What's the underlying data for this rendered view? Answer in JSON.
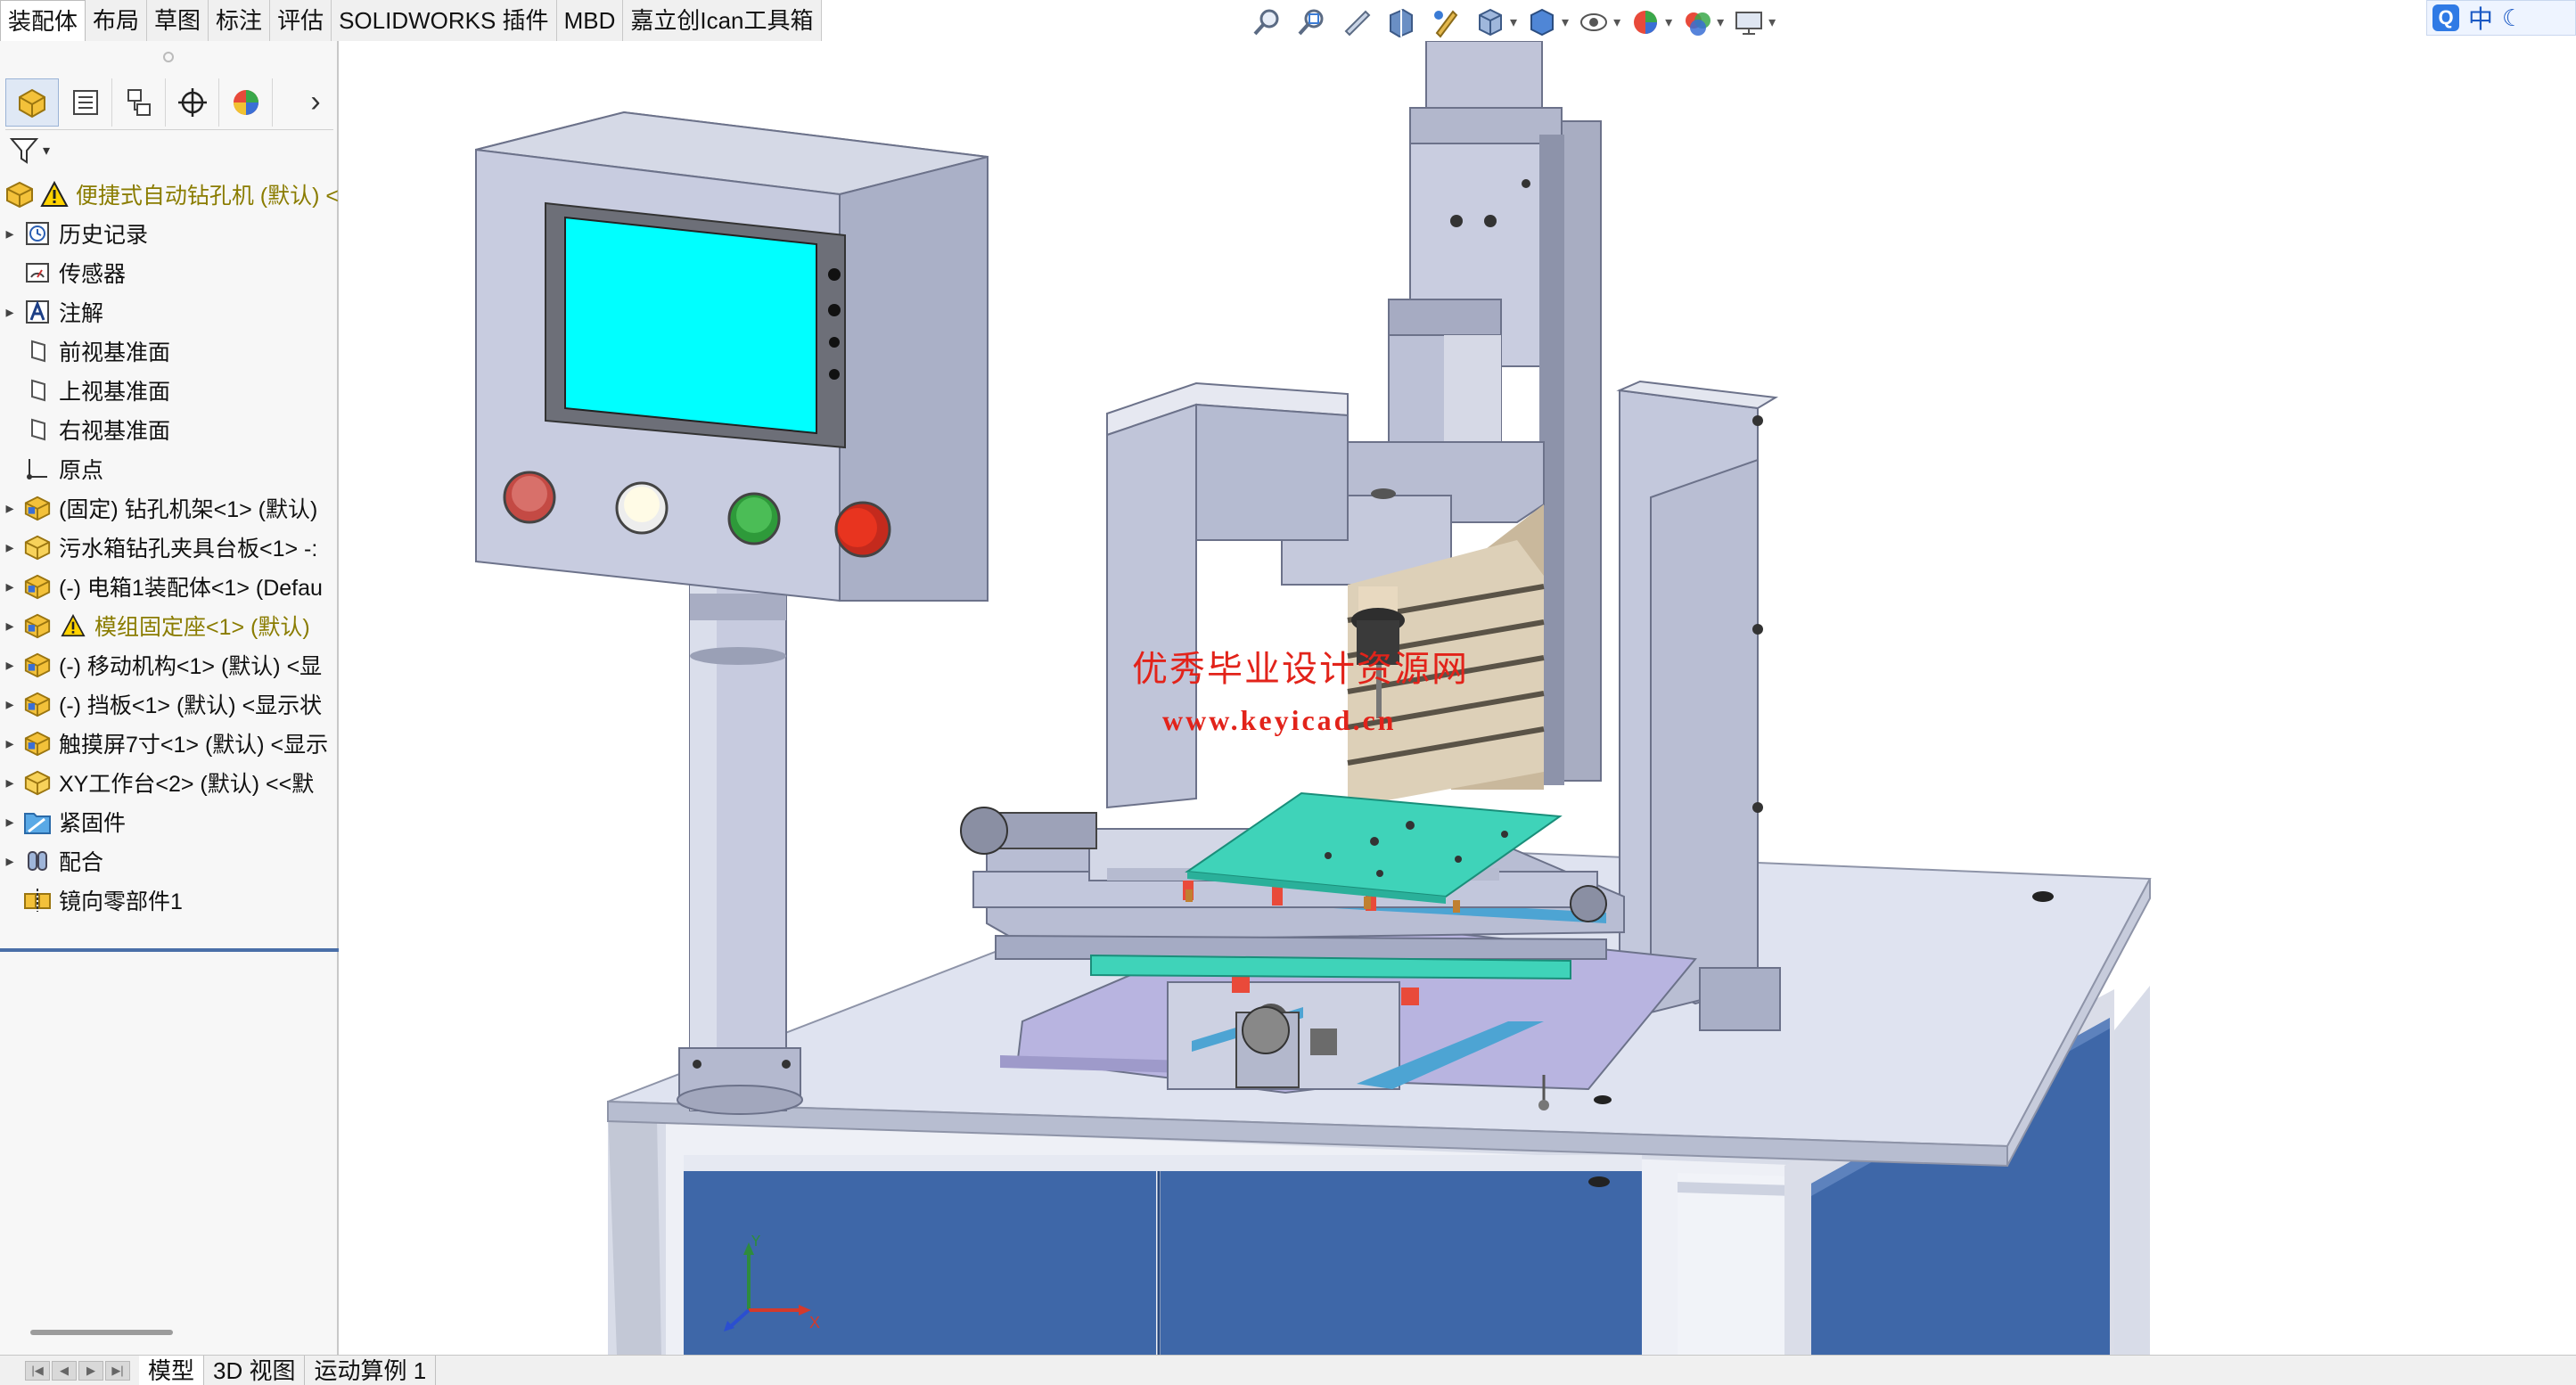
{
  "tabs": [
    {
      "label": "装配体"
    },
    {
      "label": "布局"
    },
    {
      "label": "草图"
    },
    {
      "label": "标注"
    },
    {
      "label": "评估"
    },
    {
      "label": "SOLIDWORKS 插件"
    },
    {
      "label": "MBD"
    },
    {
      "label": "嘉立创Ican工具箱"
    }
  ],
  "hud_icons": [
    "zoom-to-fit-icon",
    "zoom-area-icon",
    "previous-view-icon",
    "section-view-icon",
    "dynamic-annotation-icon",
    "view-orientation-icon",
    "display-style-icon",
    "hide-show-icon",
    "edit-appearance-icon",
    "apply-scene-icon",
    "view-settings-icon"
  ],
  "ime": {
    "lang": "中",
    "mode": "☾"
  },
  "feature_tree": {
    "root": {
      "label": "便捷式自动钻孔机 (默认) <"
    },
    "items": [
      {
        "label": "历史记录",
        "icon": "history-icon",
        "expandable": true
      },
      {
        "label": "传感器",
        "icon": "sensor-icon",
        "expandable": false
      },
      {
        "label": "注解",
        "icon": "annotation-icon",
        "expandable": true
      },
      {
        "label": "前视基准面",
        "icon": "plane-icon",
        "expandable": false
      },
      {
        "label": "上视基准面",
        "icon": "plane-icon",
        "expandable": false
      },
      {
        "label": "右视基准面",
        "icon": "plane-icon",
        "expandable": false
      },
      {
        "label": "原点",
        "icon": "origin-icon",
        "expandable": false
      },
      {
        "label": "(固定) 钻孔机架<1> (默认)",
        "icon": "subassembly-icon",
        "expandable": true
      },
      {
        "label": "污水箱钻孔夹具台板<1> -:",
        "icon": "part-icon",
        "expandable": true
      },
      {
        "label": "(-) 电箱1装配体<1> (Defau",
        "icon": "subassembly-icon",
        "expandable": true
      },
      {
        "label": "模组固定座<1> (默认)",
        "icon": "subassembly-icon",
        "expandable": true,
        "warning": true
      },
      {
        "label": "(-) 移动机构<1> (默认) <显",
        "icon": "subassembly-icon",
        "expandable": true
      },
      {
        "label": "(-) 挡板<1> (默认) <显示状",
        "icon": "subassembly-icon",
        "expandable": true
      },
      {
        "label": "触摸屏7寸<1> (默认) <显示",
        "icon": "subassembly-icon",
        "expandable": true
      },
      {
        "label": "XY工作台<2> (默认) <<默",
        "icon": "part-icon",
        "expandable": true
      },
      {
        "label": "紧固件",
        "icon": "fastener-folder-icon",
        "expandable": true
      },
      {
        "label": "配合",
        "icon": "mates-icon",
        "expandable": true
      },
      {
        "label": "镜向零部件1",
        "icon": "mirror-component-icon",
        "expandable": false
      }
    ]
  },
  "bottom_tabs": [
    {
      "label": "模型"
    },
    {
      "label": "3D 视图"
    },
    {
      "label": "运动算例 1"
    }
  ],
  "watermark": {
    "line1": "优秀毕业设计资源网",
    "line2": "www.keyicad.cn"
  },
  "triad": {
    "x": "X",
    "y": "Y"
  },
  "colors": {
    "screen": "#00ffff",
    "workplate": "#3fd3b9",
    "cabinet_door": "#3e67a8",
    "table_top": "#dfe3f0",
    "frame": "#aeb3cc",
    "button_red": "#c42a1d",
    "button_green": "#2e9a3a"
  }
}
